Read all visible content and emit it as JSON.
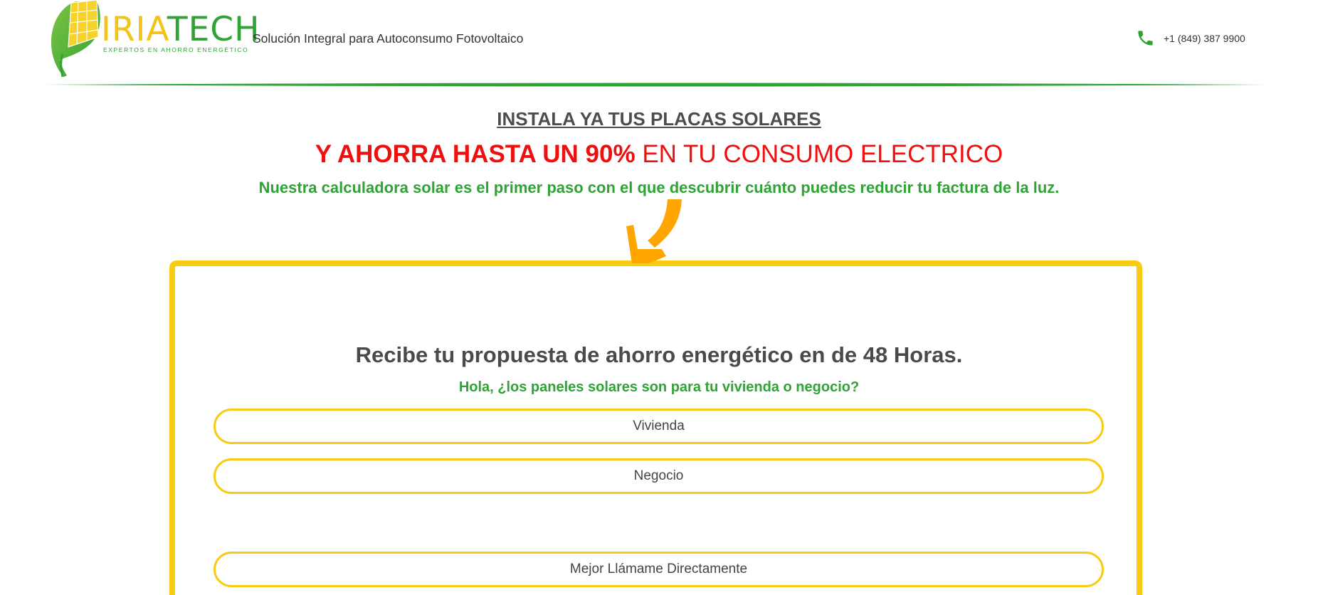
{
  "header": {
    "logo_word_left": "IRIA",
    "logo_word_right": "TECH",
    "logo_subtitle": "EXPERTOS EN AHORRO ENERGÉTICO",
    "tagline": "Solución Integral para Autoconsumo Fotovoltaico",
    "phone_icon": "phone-icon",
    "phone_number": "+1 (849) 387 9900"
  },
  "hero": {
    "install_heading": "INSTALA YA TUS PLACAS SOLARES",
    "save_bold": "Y AHORRA HASTA UN 90%",
    "save_rest": " EN TU CONSUMO ELECTRICO",
    "calculator_text": "Nuestra calculadora solar es el primer paso con el que descubrir cuánto puedes reducir tu factura de la luz.",
    "arrow_icon": "curved-arrow-down-icon"
  },
  "form": {
    "title": "Recibe tu propuesta de ahorro energético en de 48 Horas.",
    "question": "Hola, ¿los paneles solares son para tu vivienda o negocio?",
    "options": [
      {
        "label": "Vivienda"
      },
      {
        "label": "Negocio"
      },
      {
        "label": "Mejor Llámame Directamente"
      }
    ]
  },
  "colors": {
    "brand_green": "#2fa336",
    "brand_yellow": "#f9cc13",
    "accent_red": "#ee0f0f",
    "arrow_orange": "#ffa500",
    "text_dark": "#4a4a4a"
  }
}
